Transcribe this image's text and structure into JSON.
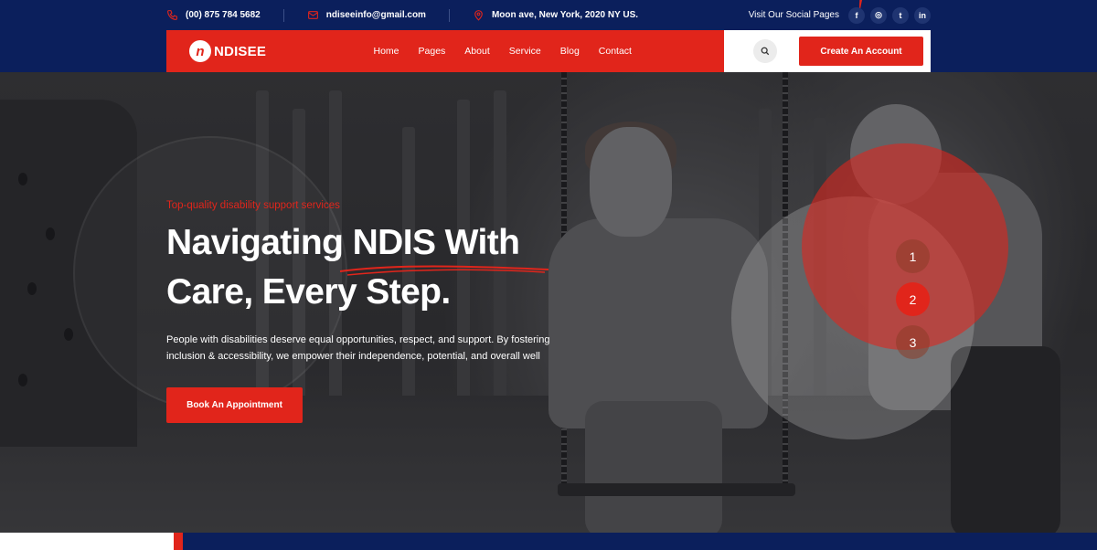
{
  "topbar": {
    "phone": "(00) 875 784 5682",
    "email": "ndiseeinfo@gmail.com",
    "address": "Moon ave, New York, 2020 NY US.",
    "social_label": "Visit Our Social Pages",
    "social": [
      {
        "icon": "facebook-icon",
        "glyph": "f"
      },
      {
        "icon": "instagram-icon",
        "glyph": "◎"
      },
      {
        "icon": "twitter-icon",
        "glyph": "t"
      },
      {
        "icon": "linkedin-icon",
        "glyph": "in"
      }
    ]
  },
  "nav": {
    "logo_text": "NDISEE",
    "links": [
      "Home",
      "Pages",
      "About",
      "Service",
      "Blog",
      "Contact"
    ],
    "cta_label": "Create An Account"
  },
  "hero": {
    "eyebrow": "Top-quality disability support services",
    "headline_line1": "Navigating NDIS With",
    "headline_line2": "Care, Every Step.",
    "description": "People with disabilities deserve equal opportunities, respect, and support. By fostering inclusion & accessibility, we empower their independence, potential, and overall well",
    "button_label": "Book An Appointment",
    "slides": [
      "1",
      "2",
      "3"
    ],
    "active_slide": "2"
  },
  "colors": {
    "brand_red": "#e1251b",
    "brand_navy": "#0b1f5c"
  }
}
